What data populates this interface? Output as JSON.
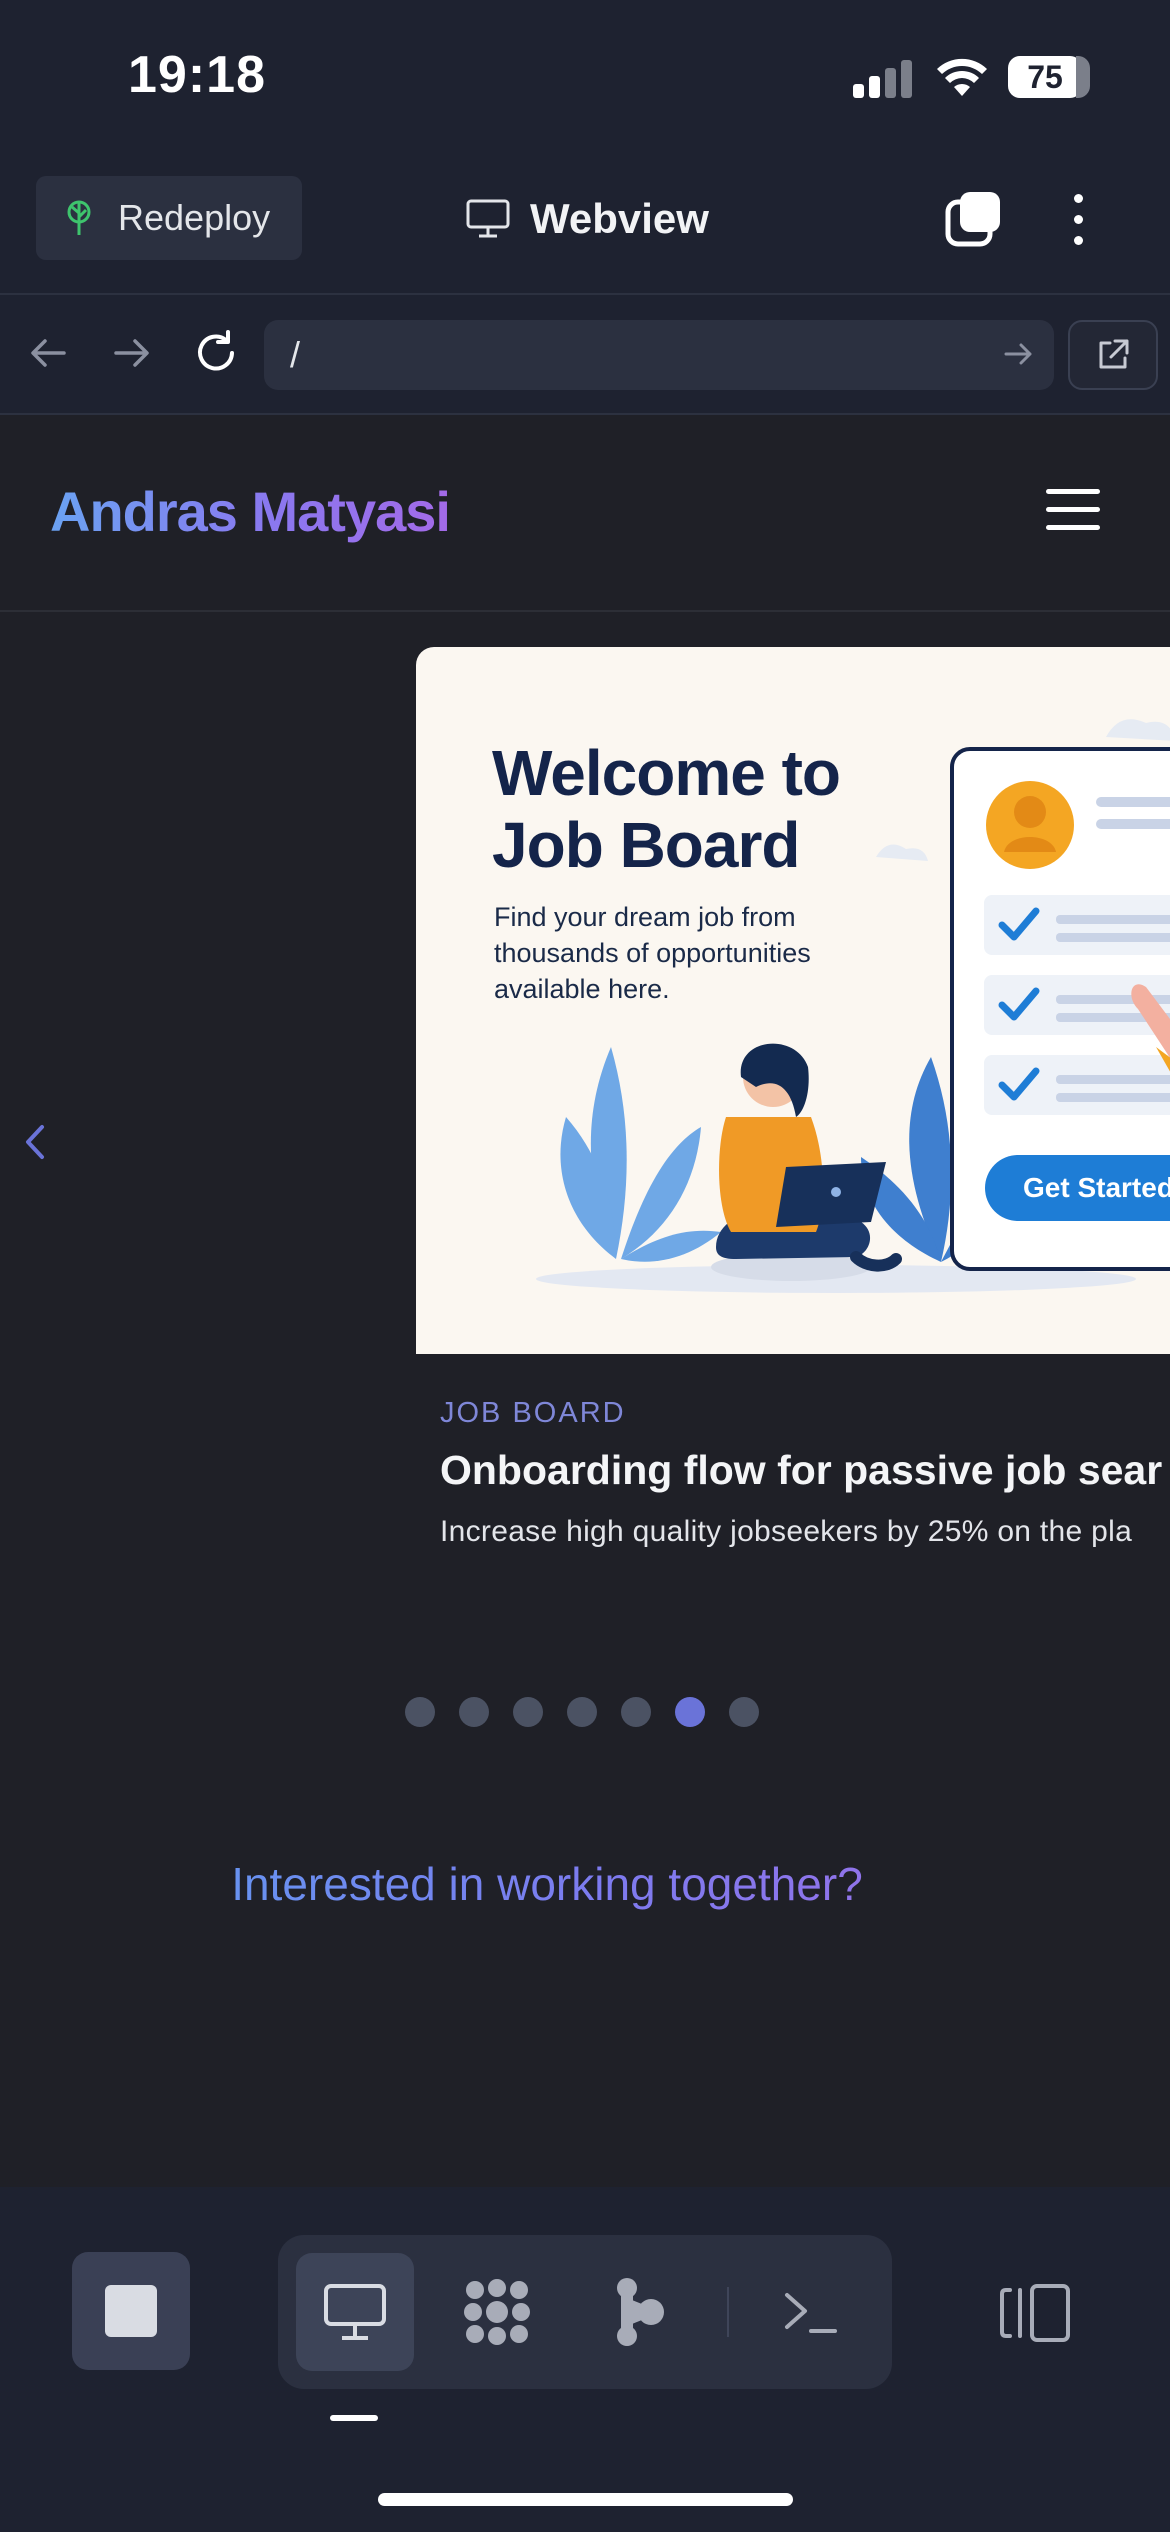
{
  "status_bar": {
    "time": "19:18",
    "battery": "75"
  },
  "header": {
    "redeploy_label": "Redeploy",
    "title": "Webview"
  },
  "urlbar": {
    "url": "/"
  },
  "site": {
    "brand": "Andras Matyasi",
    "card": {
      "image": {
        "title_line1": "Welcome to",
        "title_line2": "Job Board",
        "subtitle": "Find your dream job from thousands of opportunities available here.",
        "button_label": "Get Started"
      },
      "tag": "JOB BOARD",
      "title": "Onboarding flow for passive job sear",
      "description": "Increase high quality jobseekers by 25% on the pla"
    },
    "carousel": {
      "total_slides": 7,
      "active_slide": 6
    },
    "cta": "Interested in working together?"
  },
  "colors": {
    "background": "#1f2027",
    "chrome": "#1e2230",
    "accent": "#6a73d8",
    "brand_gradient_start": "#6aa2f2",
    "brand_gradient_end": "#a36ae8"
  }
}
